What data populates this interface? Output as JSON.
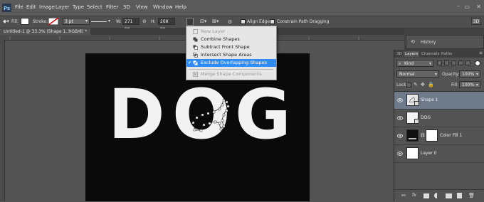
{
  "menubar": {
    "items": [
      "File",
      "Edit",
      "Image",
      "Layer",
      "Type",
      "Select",
      "Filter",
      "3D",
      "View",
      "Window",
      "Help"
    ]
  },
  "options": {
    "fill_label": "Fill:",
    "stroke_label": "Stroke:",
    "stroke_width": "3 pt",
    "w_label": "W:",
    "w_value": "271 px",
    "h_label": "H:",
    "h_value": "268 px",
    "align_edges": "Align Edges",
    "constrain_path": "Constrain Path Dragging",
    "workspace": "3D"
  },
  "document": {
    "tab_title": "Untitled-1 @ 33.3% (Shape 1, RGB/8) *"
  },
  "canvas_text": [
    "D",
    "O",
    "G"
  ],
  "dropdown": {
    "items": [
      {
        "label": "New Layer",
        "state": "disabled"
      },
      {
        "label": "Combine Shapes",
        "state": "normal"
      },
      {
        "label": "Subtract Front Shape",
        "state": "normal"
      },
      {
        "label": "Intersect Shape Areas",
        "state": "normal"
      },
      {
        "label": "Exclude Overlapping Shapes",
        "state": "selected"
      },
      {
        "label": "Merge Shape Components",
        "state": "disabled"
      }
    ]
  },
  "history": {
    "label": "History"
  },
  "layers_panel": {
    "tabs": [
      "3D",
      "Layers",
      "Channels",
      "Paths"
    ],
    "kind": "Kind",
    "blend_mode": "Normal",
    "opacity_label": "Opacity:",
    "opacity": "100%",
    "lock_label": "Lock:",
    "fill_label": "Fill:",
    "fill": "100%",
    "layers": [
      {
        "name": "Shape 1",
        "selected": true
      },
      {
        "name": "DOG",
        "selected": false
      },
      {
        "name": "Color Fill 1",
        "selected": false
      },
      {
        "name": "Layer 0",
        "selected": false
      }
    ],
    "footer_icons": [
      "link-icon",
      "fx-icon",
      "mask-icon",
      "adjustment-icon",
      "group-icon",
      "new-layer-icon",
      "trash-icon"
    ]
  },
  "colors": {
    "selected_menu": "#2f8cf4",
    "canvas_bg": "#0a0a0a",
    "letter": "#f2f2f2"
  }
}
